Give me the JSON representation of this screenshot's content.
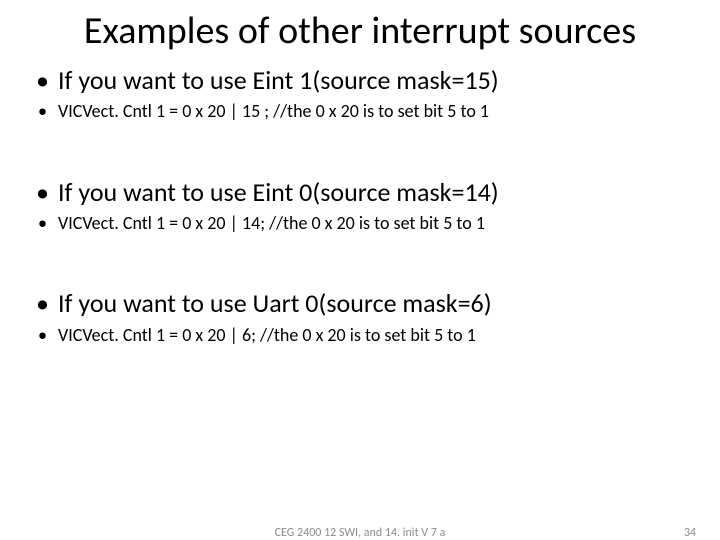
{
  "title": "Examples of other interrupt sources",
  "bullets": {
    "b1": "If you want to use Eint 1(source mask=15)",
    "b2": "VICVect. Cntl 1 = 0 x 20 | 15 ; //the 0 x 20 is to set bit 5 to 1",
    "b3": "If you want to use Eint 0(source mask=14)",
    "b4": "VICVect. Cntl 1 = 0 x 20 | 14; //the 0 x 20 is to set bit 5 to 1",
    "b5": "If you want to use Uart 0(source mask=6)",
    "b6": "VICVect. Cntl 1 = 0 x 20 | 6; //the 0 x 20 is to set bit 5 to 1"
  },
  "footer": {
    "center": "CEG 2400 12 SWI, and 14. init V 7 a",
    "page": "34"
  }
}
